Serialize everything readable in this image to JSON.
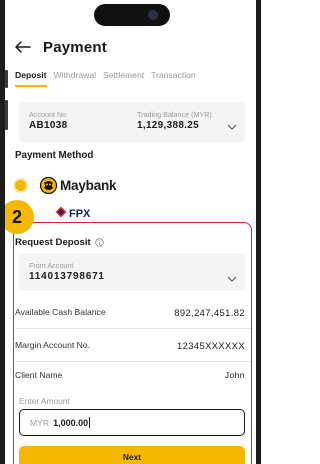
{
  "header": {
    "title": "Payment"
  },
  "tabs": [
    {
      "label": "Deposit",
      "active": true
    },
    {
      "label": "Withdrawal",
      "active": false
    },
    {
      "label": "Settlement",
      "active": false
    },
    {
      "label": "Transaction",
      "active": false
    }
  ],
  "account": {
    "account_label": "Account No.",
    "account_value": "AB1038",
    "balance_label": "Trading Balance (MYR)",
    "balance_value": "1,129,388.25"
  },
  "payment_method": {
    "title": "Payment Method",
    "options": [
      {
        "label": "Maybank",
        "selected": true,
        "icon": "maybank-tiger-logo"
      },
      {
        "label": "FPX",
        "selected": false,
        "icon": "fpx-logo"
      }
    ]
  },
  "step": {
    "number": "2"
  },
  "request": {
    "title": "Request Deposit",
    "from_label": "From Account",
    "from_value": "114013798671",
    "rows": [
      {
        "label": "Available Cash Balance",
        "value": "892,247,451.82"
      },
      {
        "label": "Margin Account No.",
        "value": "12345XXXXXX"
      },
      {
        "label": "Client Name",
        "value": "John"
      }
    ],
    "amount_label": "Enter Amount",
    "amount_currency": "MYR",
    "amount_value": "1,000.00",
    "next_label": "Next"
  },
  "colors": {
    "accent": "#f5b800",
    "highlight": "#e0252b",
    "fpx_blue": "#1a1f5c"
  }
}
